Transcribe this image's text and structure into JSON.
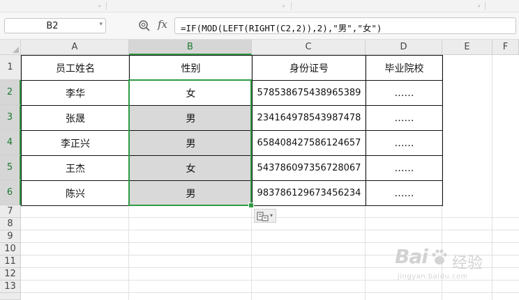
{
  "name_box": {
    "value": "B2"
  },
  "formula_bar": {
    "fx_label": "fx",
    "formula": "=IF(MOD(LEFT(RIGHT(C2,2)),2),\"男\",\"女\")"
  },
  "columns": [
    "A",
    "B",
    "C",
    "D",
    "E",
    "F"
  ],
  "rows": [
    "1",
    "2",
    "3",
    "4",
    "5",
    "6",
    "7",
    "8",
    "9",
    "10",
    "11",
    "12",
    "13"
  ],
  "table": {
    "headers": [
      "员工姓名",
      "性别",
      "身份证号",
      "毕业院校"
    ],
    "rows": [
      [
        "李华",
        "女",
        "578538675438965389",
        "……"
      ],
      [
        "张晟",
        "男",
        "234164978543987478",
        "……"
      ],
      [
        "李正兴",
        "男",
        "658408427586124657",
        "……"
      ],
      [
        "王杰",
        "女",
        "543786097356728067",
        "……"
      ],
      [
        "陈兴",
        "男",
        "983786129673456234",
        "……"
      ]
    ]
  },
  "selection": {
    "column": "B",
    "rows": [
      "2",
      "3",
      "4",
      "5",
      "6"
    ]
  },
  "watermark": {
    "brand": "Bai",
    "brand2": "经验",
    "url": "jingyan.baidu.com"
  },
  "colors": {
    "accent": "#2e9b43",
    "selected_fill": "#d9d9d9"
  }
}
